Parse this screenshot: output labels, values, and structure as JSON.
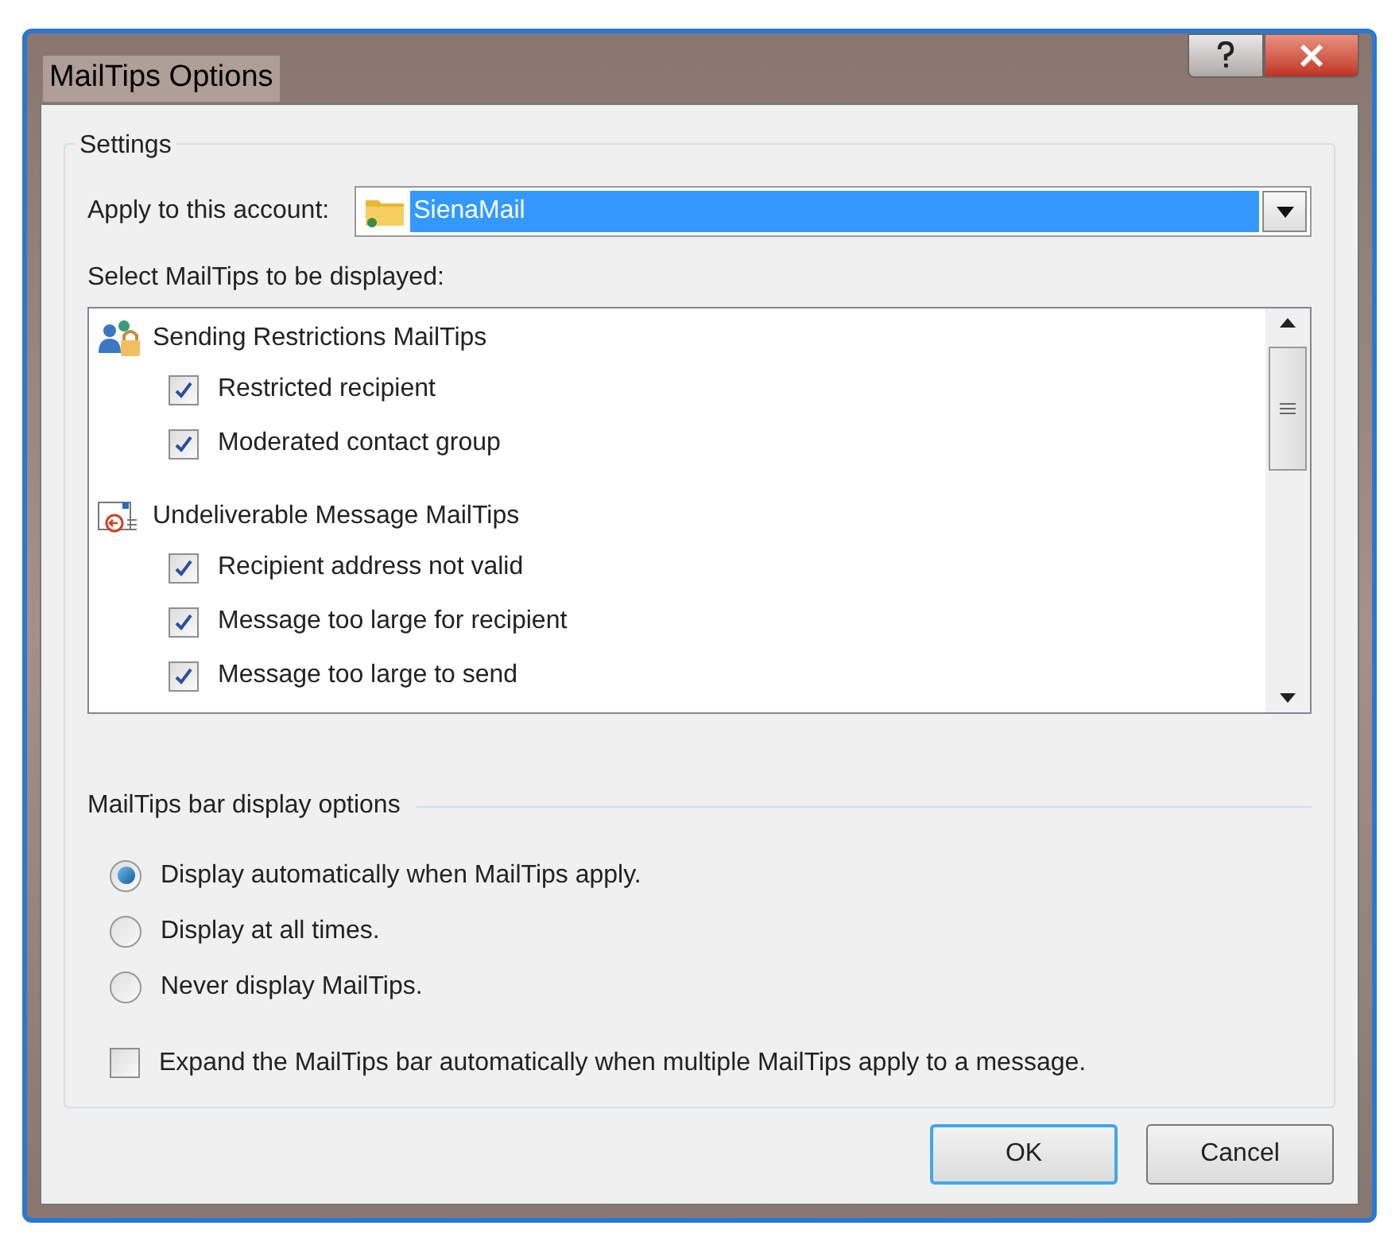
{
  "window": {
    "title": "MailTips Options"
  },
  "settings": {
    "title": "Settings",
    "account": {
      "label": "Apply to this account:",
      "value": "SienaMail"
    },
    "list_label": "Select MailTips to be displayed:",
    "groups": [
      {
        "title": "Sending Restrictions MailTips",
        "kind": "restrictions",
        "items": [
          {
            "label": "Restricted recipient",
            "checked": true
          },
          {
            "label": "Moderated contact group",
            "checked": true
          }
        ]
      },
      {
        "title": "Undeliverable Message MailTips",
        "kind": "undeliverable",
        "items": [
          {
            "label": "Recipient address not valid",
            "checked": true
          },
          {
            "label": "Message too large for recipient",
            "checked": true
          },
          {
            "label": "Message too large to send",
            "checked": true
          }
        ]
      }
    ]
  },
  "bar_options": {
    "title": "MailTips bar display options",
    "radios": [
      {
        "label": "Display automatically when MailTips apply.",
        "selected": true
      },
      {
        "label": "Display at all times.",
        "selected": false
      },
      {
        "label": "Never display MailTips.",
        "selected": false
      }
    ],
    "expand": {
      "label": "Expand the MailTips bar automatically when multiple MailTips apply to a message.",
      "checked": false
    }
  },
  "buttons": [
    {
      "label": "OK",
      "kind": "default"
    },
    {
      "label": "Cancel",
      "kind": "normal"
    }
  ]
}
